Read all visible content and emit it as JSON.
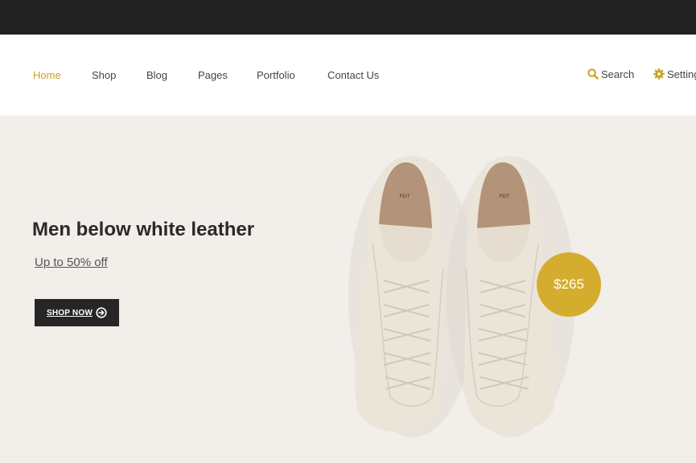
{
  "nav": {
    "items": [
      {
        "label": "Home",
        "active": true
      },
      {
        "label": "Shop"
      },
      {
        "label": "Blog"
      },
      {
        "label": "Pages"
      },
      {
        "label": "Portfolio"
      },
      {
        "label": "Contact Us"
      }
    ],
    "search_label": "Search",
    "settings_label": "Settings",
    "search_icon": "search-icon",
    "settings_icon": "gear-icon"
  },
  "hero": {
    "title": "Men below white leather",
    "subtitle": "Up to 50% off",
    "button_label": "SHOP NOW",
    "button_icon": "arrow-right-circle-icon",
    "price": "$265"
  },
  "colors": {
    "topbar": "#222222",
    "accent": "#c9a21c",
    "hero_bg": "#f2eeea",
    "price_badge": "#d4ad2e",
    "button_bg": "#262626"
  }
}
